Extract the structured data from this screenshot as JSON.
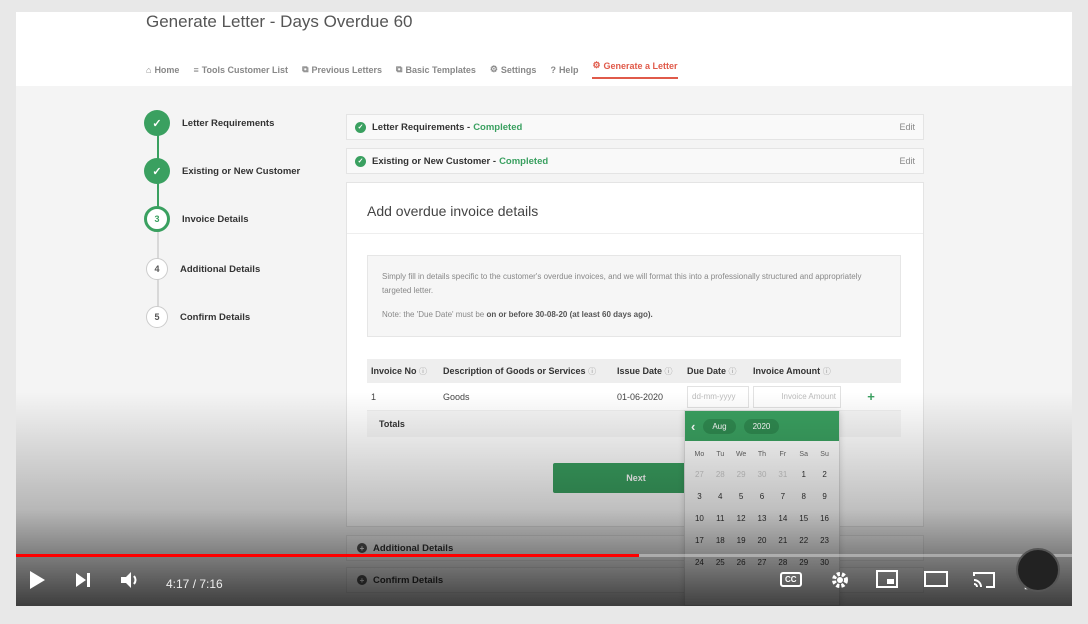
{
  "header": {
    "title": "Generate Letter - Days Overdue 60",
    "nav": [
      {
        "icon": "home-icon",
        "glyph": "⌂",
        "label": "Home"
      },
      {
        "icon": "list-icon",
        "glyph": "≡",
        "label": "Tools Customer List"
      },
      {
        "icon": "copy-icon",
        "glyph": "⧉",
        "label": "Previous Letters"
      },
      {
        "icon": "copy-icon",
        "glyph": "⧉",
        "label": "Basic Templates"
      },
      {
        "icon": "gear-icon",
        "glyph": "⚙",
        "label": "Settings"
      },
      {
        "icon": "help-icon",
        "glyph": "?",
        "label": "Help"
      },
      {
        "icon": "cogs-icon",
        "glyph": "⚙",
        "label": "Generate a Letter"
      }
    ]
  },
  "steps": [
    {
      "marker": "✓",
      "label": "Letter Requirements"
    },
    {
      "marker": "✓",
      "label": "Existing or New Customer"
    },
    {
      "marker": "3",
      "label": "Invoice Details"
    },
    {
      "marker": "4",
      "label": "Additional Details"
    },
    {
      "marker": "5",
      "label": "Confirm Details"
    }
  ],
  "completed": [
    {
      "label": "Letter Requirements -",
      "status": "Completed",
      "edit": "Edit"
    },
    {
      "label": "Existing or New Customer -",
      "status": "Completed",
      "edit": "Edit"
    }
  ],
  "card": {
    "title": "Add overdue invoice details",
    "info_text": "Simply fill in details specific to the customer's overdue invoices, and we will format this into a professionally structured and appropriately targeted letter.",
    "note_prefix": "Note: the 'Due Date' must be",
    "note_bold": "on or before 30-08-20 (at least 60 days ago).",
    "table": {
      "headers": [
        "Invoice No",
        "Description of Goods or Services",
        "Issue Date",
        "Due Date",
        "Invoice Amount"
      ],
      "row": {
        "invoice_no": "1",
        "description": "Goods",
        "issue_date": "01-06-2020",
        "due_date_placeholder": "dd-mm-yyyy",
        "amount_placeholder": "Invoice Amount"
      },
      "add_glyph": "+",
      "totals_label": "Totals"
    },
    "next_label": "Next"
  },
  "collapsed": [
    {
      "label": "Additional Details"
    },
    {
      "label": "Confirm Details"
    }
  ],
  "datepicker": {
    "prev_glyph": "‹",
    "month": "Aug",
    "year": "2020",
    "weekdays": [
      "Mo",
      "Tu",
      "We",
      "Th",
      "Fr",
      "Sa",
      "Su"
    ],
    "days": [
      {
        "d": "27",
        "muted": true
      },
      {
        "d": "28",
        "muted": true
      },
      {
        "d": "29",
        "muted": true
      },
      {
        "d": "30",
        "muted": true
      },
      {
        "d": "31",
        "muted": true
      },
      {
        "d": "1"
      },
      {
        "d": "2"
      },
      {
        "d": "3"
      },
      {
        "d": "4"
      },
      {
        "d": "5"
      },
      {
        "d": "6"
      },
      {
        "d": "7"
      },
      {
        "d": "8"
      },
      {
        "d": "9"
      },
      {
        "d": "10"
      },
      {
        "d": "11"
      },
      {
        "d": "12"
      },
      {
        "d": "13"
      },
      {
        "d": "14"
      },
      {
        "d": "15"
      },
      {
        "d": "16"
      },
      {
        "d": "17"
      },
      {
        "d": "18"
      },
      {
        "d": "19"
      },
      {
        "d": "20"
      },
      {
        "d": "21"
      },
      {
        "d": "22"
      },
      {
        "d": "23"
      },
      {
        "d": "24"
      },
      {
        "d": "25"
      },
      {
        "d": "26"
      },
      {
        "d": "27"
      },
      {
        "d": "28"
      },
      {
        "d": "29"
      },
      {
        "d": "30"
      }
    ]
  },
  "player": {
    "time": "4:17 / 7:16",
    "progress": 0.59,
    "cc_label": "CC",
    "accent": "#ff0000"
  },
  "colors": {
    "brand_green": "#3aa060",
    "active_nav": "#e05a4a"
  }
}
